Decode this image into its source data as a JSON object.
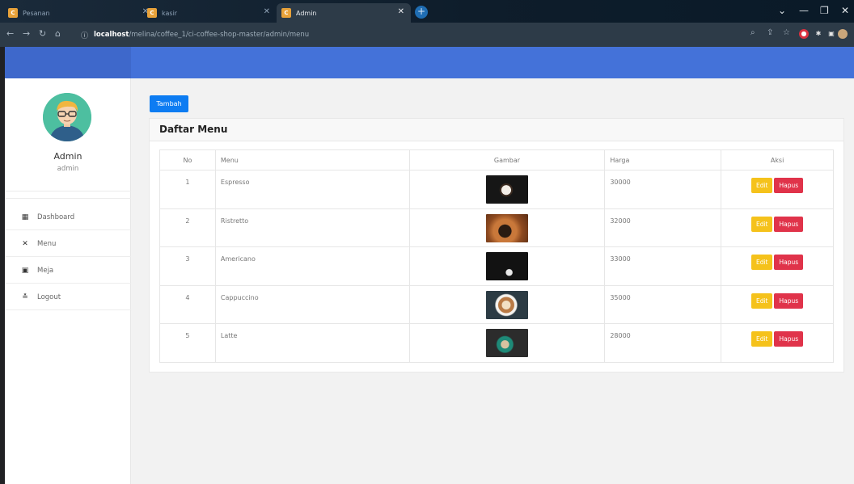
{
  "browser": {
    "tabs": [
      {
        "label": "Pesanan",
        "active": false
      },
      {
        "label": "kasir",
        "active": false
      },
      {
        "label": "Admin",
        "active": true
      }
    ],
    "url_host": "localhost",
    "url_path": "/melina/coffee_1/ci-coffee-shop-master/admin/menu"
  },
  "sidebar": {
    "user_name": "Admin",
    "user_role": "admin",
    "items": [
      {
        "label": "Dashboard",
        "icon": "dashboard-icon"
      },
      {
        "label": "Menu",
        "icon": "utensils-icon"
      },
      {
        "label": "Meja",
        "icon": "table-icon"
      },
      {
        "label": "Logout",
        "icon": "user-icon"
      }
    ]
  },
  "main": {
    "add_button": "Tambah",
    "card_title": "Daftar Menu",
    "columns": [
      "No",
      "Menu",
      "Gambar",
      "Harga",
      "Aksi"
    ],
    "rows": [
      {
        "no": "1",
        "menu": "Espresso",
        "harga": "30000"
      },
      {
        "no": "2",
        "menu": "Ristretto",
        "harga": "32000"
      },
      {
        "no": "3",
        "menu": "Americano",
        "harga": "33000"
      },
      {
        "no": "4",
        "menu": "Cappuccino",
        "harga": "35000"
      },
      {
        "no": "5",
        "menu": "Latte",
        "harga": "28000"
      }
    ],
    "edit_label": "Edit",
    "delete_label": "Hapus"
  },
  "colors": {
    "topbar": "#4472d9",
    "primary_button": "#0d7cf2",
    "edit_button": "#f5c21b",
    "delete_button": "#e0334a"
  }
}
